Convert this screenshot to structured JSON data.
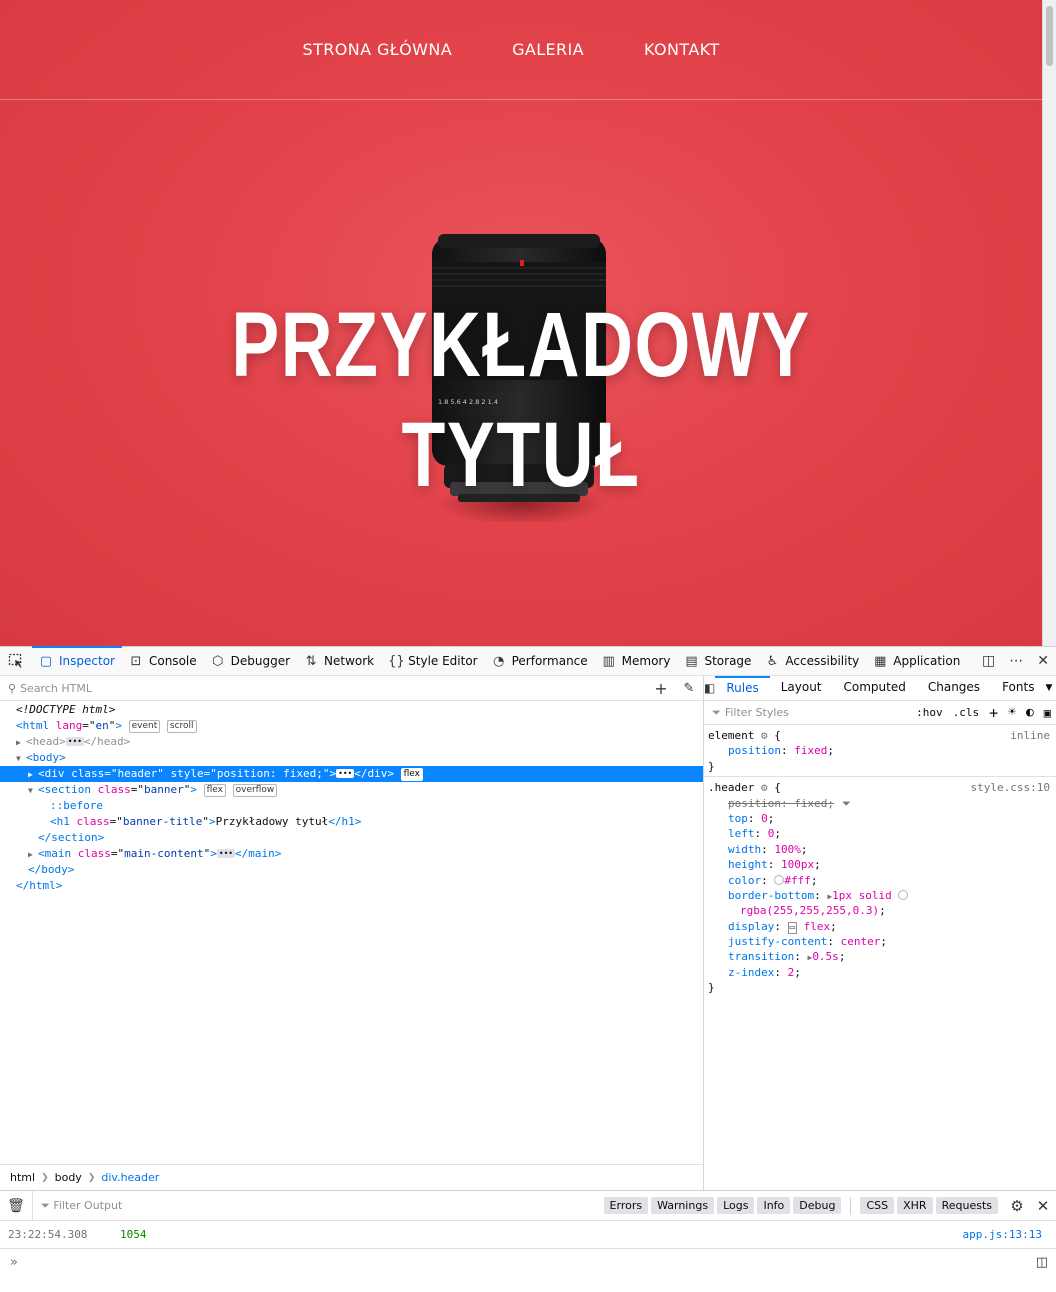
{
  "page": {
    "nav": [
      "STRONA GŁÓWNA",
      "GALERIA",
      "KONTAKT"
    ],
    "banner_title": "PRZYKŁADOWY TYTUŁ"
  },
  "devtools": {
    "tabs": [
      {
        "label": "Inspector",
        "icon": "inspector-icon"
      },
      {
        "label": "Console",
        "icon": "console-icon"
      },
      {
        "label": "Debugger",
        "icon": "debugger-icon"
      },
      {
        "label": "Network",
        "icon": "network-icon"
      },
      {
        "label": "Style Editor",
        "icon": "style-editor-icon"
      },
      {
        "label": "Performance",
        "icon": "performance-icon"
      },
      {
        "label": "Memory",
        "icon": "memory-icon"
      },
      {
        "label": "Storage",
        "icon": "storage-icon"
      },
      {
        "label": "Accessibility",
        "icon": "accessibility-icon"
      },
      {
        "label": "Application",
        "icon": "application-icon"
      }
    ],
    "active_tab": "Inspector",
    "markup": {
      "search_placeholder": "Search HTML",
      "doctype": "<!DOCTYPE html>",
      "html_lang": "en",
      "badges": {
        "event": "event",
        "scroll": "scroll",
        "flex": "flex",
        "overflow": "overflow"
      },
      "header_div_class": "header",
      "header_div_style": "position: fixed;",
      "section_class": "banner",
      "pseudo": "::before",
      "h1_class": "banner-title",
      "h1_text": "Przykładowy tytuł",
      "main_class": "main-content",
      "breadcrumbs": [
        "html",
        "body",
        "div.header"
      ]
    },
    "sidebar": {
      "tabs": [
        "Rules",
        "Layout",
        "Computed",
        "Changes",
        "Fonts"
      ],
      "active_tab": "Rules",
      "filter_placeholder": "Filter Styles",
      "hov": ":hov",
      "cls": ".cls",
      "element_rule": {
        "selector": "element",
        "source": "inline",
        "props": [
          {
            "name": "position",
            "value": "fixed"
          }
        ]
      },
      "header_rule": {
        "selector": ".header",
        "source": "style.css:10",
        "props": [
          {
            "name": "position",
            "value": "fixed",
            "overridden": true
          },
          {
            "name": "top",
            "value": "0"
          },
          {
            "name": "left",
            "value": "0"
          },
          {
            "name": "width",
            "value": "100%"
          },
          {
            "name": "height",
            "value": "100px"
          },
          {
            "name": "color",
            "value": "#fff"
          },
          {
            "name": "border-bottom",
            "value": "1px solid",
            "value2": "rgba(255,255,255,0.3)"
          },
          {
            "name": "display",
            "value": "flex"
          },
          {
            "name": "justify-content",
            "value": "center"
          },
          {
            "name": "transition",
            "value": "0.5s"
          },
          {
            "name": "z-index",
            "value": "2"
          }
        ]
      }
    },
    "console": {
      "filter_placeholder": "Filter Output",
      "filters": [
        "Errors",
        "Warnings",
        "Logs",
        "Info",
        "Debug"
      ],
      "net_filters": [
        "CSS",
        "XHR",
        "Requests"
      ],
      "message": {
        "timestamp": "23:22:54.308",
        "value": "1054",
        "location": "app.js:13:13"
      }
    }
  },
  "colors": {
    "banner_red": "#e3434a",
    "accent": "#0a84ff",
    "tag": "#0074e8",
    "attr": "#dd00a9"
  }
}
